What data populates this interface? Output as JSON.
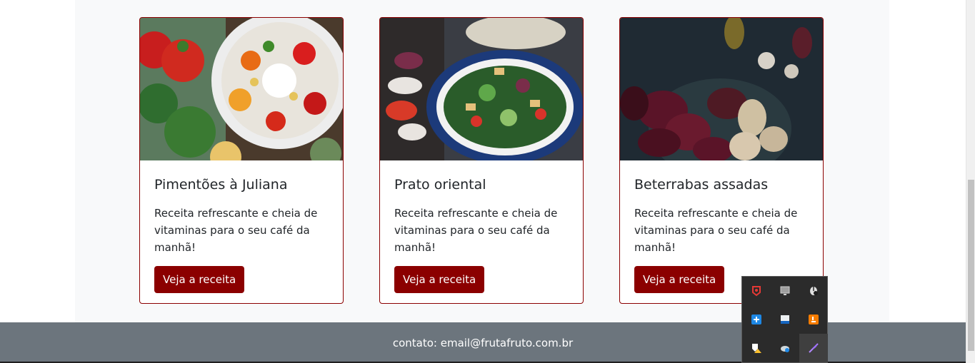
{
  "cards": [
    {
      "title": "Pimentões à Juliana",
      "text": "Receita refrescante e cheia de vitaminas para o seu café da manhã!",
      "button": "Veja a receita",
      "image_icon": "peppers-salad-photo"
    },
    {
      "title": "Prato oriental",
      "text": "Receita refrescante e cheia de vitaminas para o seu café da manhã!",
      "button": "Veja a receita",
      "image_icon": "oriental-salad-photo"
    },
    {
      "title": "Beterrabas assadas",
      "text": "Receita refrescante e cheia de vitaminas para o seu café da manhã!",
      "button": "Veja a receita",
      "image_icon": "roasted-beets-photo"
    }
  ],
  "footer": {
    "contact": "contato: email@frutafruto.com.br"
  },
  "tray_icons": [
    "antivirus-icon",
    "display-icon",
    "mouse-icon",
    "network-app-icon",
    "window-icon",
    "java-icon",
    "defender-warning-icon",
    "cloud-sync-icon",
    "feather-icon"
  ],
  "colors": {
    "accent": "#8b0000",
    "footer_bg": "#6c757d",
    "content_bg": "#f8f9fa"
  }
}
